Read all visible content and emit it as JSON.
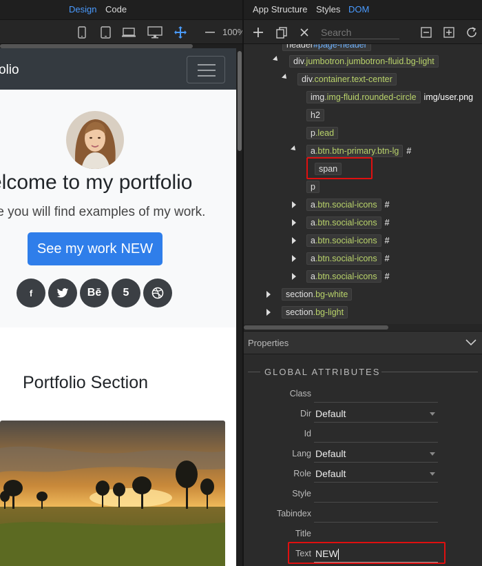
{
  "left": {
    "tabs": {
      "design": "Design",
      "code": "Code"
    },
    "zoom": "100%",
    "preview": {
      "brand": "olio",
      "hero_title": "elcome to my portfolio",
      "hero_lead": "re you will find examples of my work.",
      "cta_label": "See my work",
      "cta_span": "NEW",
      "social": [
        {
          "glyph": "f",
          "icon": "facebook-icon"
        },
        {
          "glyph": "🐦",
          "icon": "twitter-icon"
        },
        {
          "glyph": "Bē",
          "icon": "behance-icon"
        },
        {
          "glyph": "5",
          "icon": "500px-icon"
        },
        {
          "glyph": "◎",
          "icon": "dribbble-icon"
        }
      ],
      "portfolio_heading": "Portfolio Section"
    }
  },
  "right": {
    "tabs": {
      "structure": "App Structure",
      "styles": "Styles",
      "dom": "DOM"
    },
    "search_placeholder": "Search",
    "dom_nodes": {
      "header_tag": "header",
      "header_id": "#page-header",
      "jumbo_tag": "div",
      "jumbo_cls": ".jumbotron.jumbotron-fluid.bg-light",
      "container_tag": "div",
      "container_cls": ".container.text-center",
      "img_tag": "img",
      "img_cls": ".img-fluid.rounded-circle",
      "img_src": "img/user.png",
      "h2": "h2",
      "p_tag": "p",
      "p_cls": ".lead",
      "btn_tag": "a",
      "btn_cls": ".btn.btn-primary.btn-lg",
      "hash": "#",
      "span": "span",
      "p2": "p",
      "social_tag": "a",
      "social_cls": ".btn.social-icons",
      "section_tag": "section",
      "section1_cls": ".bg-white",
      "section2_cls": ".bg-light"
    },
    "properties": {
      "title": "Properties",
      "global_label": "GLOBAL ATTRIBUTES",
      "rows": [
        {
          "label": "Class",
          "value": ""
        },
        {
          "label": "Dir",
          "value": "Default"
        },
        {
          "label": "Id",
          "value": ""
        },
        {
          "label": "Lang",
          "value": "Default"
        },
        {
          "label": "Role",
          "value": "Default"
        },
        {
          "label": "Style",
          "value": ""
        },
        {
          "label": "Tabindex",
          "value": ""
        },
        {
          "label": "Title",
          "value": ""
        },
        {
          "label": "Text",
          "value": "NEW"
        }
      ]
    }
  },
  "colors": {
    "accent": "#4a9bff",
    "primary_button": "#2f7eea",
    "highlight": "#e01010",
    "class_text": "#b9d36a"
  }
}
